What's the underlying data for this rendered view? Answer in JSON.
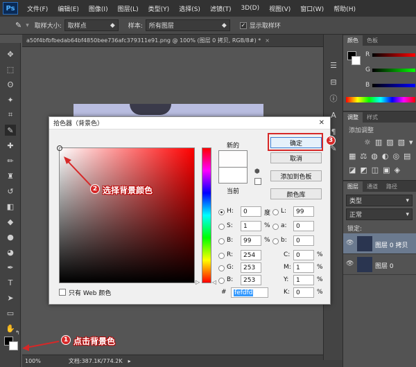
{
  "menu": [
    "文件(F)",
    "编辑(E)",
    "图像(I)",
    "图层(L)",
    "类型(Y)",
    "选择(S)",
    "滤镜(T)",
    "3D(D)",
    "视图(V)",
    "窗口(W)",
    "帮助(H)"
  ],
  "options": {
    "sample_size_label": "取样大小:",
    "sample_size_value": "取样点",
    "sample_label": "样本:",
    "sample_value": "所有图层",
    "show_ring_label": "显示取样环"
  },
  "doc_tab": "a50f4bfbfbedab64bf4850bee736afc379311e91.png @ 100% (图层 0 拷贝, RGB/8#) *",
  "status": {
    "zoom": "100%",
    "doc": "文档:387.1K/774.2K"
  },
  "color_panel": {
    "tabs": [
      "颜色",
      "色板"
    ],
    "channels": [
      "R",
      "G",
      "B"
    ]
  },
  "adj_panel": {
    "tabs": [
      "调整",
      "样式"
    ],
    "title": "添加调整"
  },
  "layers_panel": {
    "tabs": [
      "图层",
      "通道",
      "路径"
    ],
    "filter": "类型",
    "blend": "正常",
    "lock": "锁定:",
    "layers": [
      {
        "name": "图层 0 拷贝"
      },
      {
        "name": "图层 0"
      }
    ]
  },
  "dialog": {
    "title": "拾色器（背景色）",
    "new_label": "新的",
    "current_label": "当前",
    "ok": "确定",
    "cancel": "取消",
    "add_swatch": "添加到色板",
    "color_lib": "颜色库",
    "web_only": "只有 Web 颜色",
    "hash": "#",
    "hex": "fefdfd",
    "hsb": [
      {
        "label": "H:",
        "value": "0",
        "unit": "度"
      },
      {
        "label": "S:",
        "value": "1",
        "unit": "%"
      },
      {
        "label": "B:",
        "value": "99",
        "unit": "%"
      }
    ],
    "rgb": [
      {
        "label": "R:",
        "value": "254"
      },
      {
        "label": "G:",
        "value": "253"
      },
      {
        "label": "B:",
        "value": "253"
      }
    ],
    "lab": [
      {
        "label": "L:",
        "value": "99"
      },
      {
        "label": "a:",
        "value": "0"
      },
      {
        "label": "b:",
        "value": "0"
      }
    ],
    "cmyk": [
      {
        "label": "C:",
        "value": "0",
        "unit": "%"
      },
      {
        "label": "M:",
        "value": "1",
        "unit": "%"
      },
      {
        "label": "Y:",
        "value": "1",
        "unit": "%"
      },
      {
        "label": "K:",
        "value": "0",
        "unit": "%"
      }
    ]
  },
  "annotations": {
    "step1": "点击背景色",
    "step2": "选择背景颜色",
    "n1": "1",
    "n2": "2",
    "n3": "3"
  },
  "colors": {
    "hue": "#ff0000",
    "new_color": "#fefdfd",
    "current_color": "#ffffff",
    "accent": "#d62828"
  }
}
